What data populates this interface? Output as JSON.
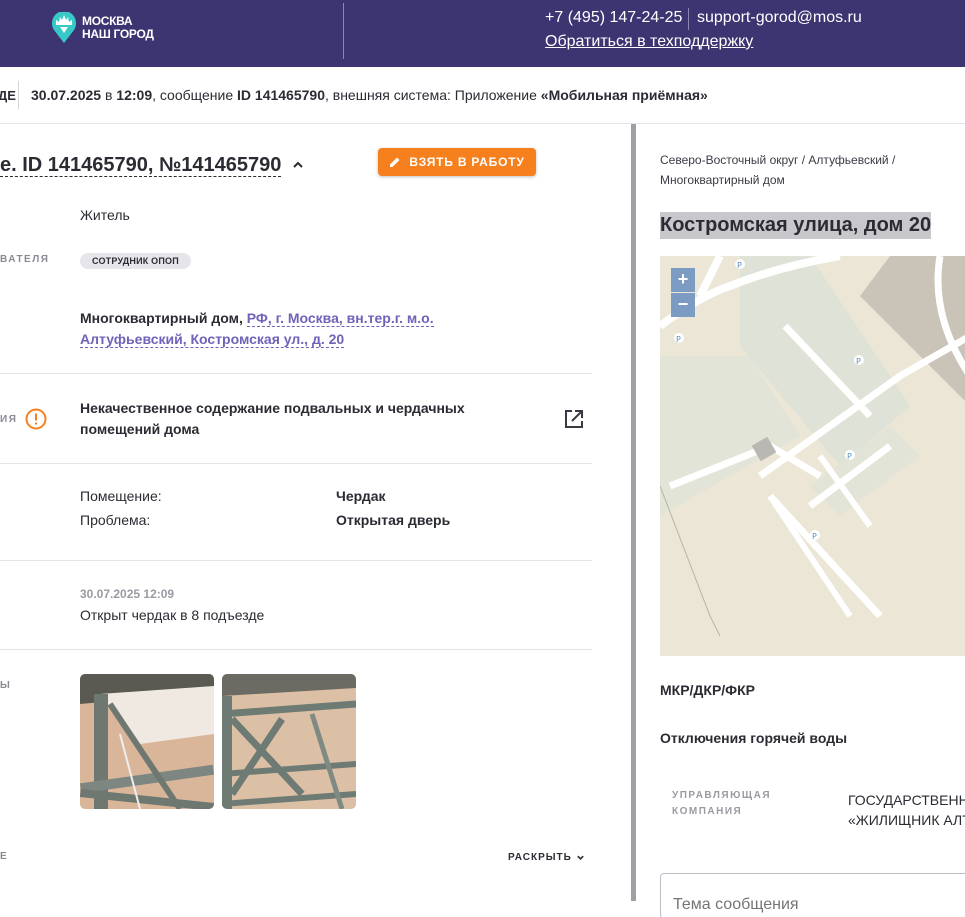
{
  "header": {
    "logo_line1": "МОСКВА",
    "logo_line2": "НАШ ГОРОД",
    "phone": "+7 (495) 147-24-25",
    "email": "support-gorod@mos.ru",
    "support_link": "Обратиться в техподдержку",
    "bg_color": "#3d3472"
  },
  "infobar": {
    "cut_label": "ДЕ",
    "date": "30.07.2025",
    "in_word": "в",
    "time": "12:09",
    "msg_word": ", сообщение",
    "id_label": "ID 141465790",
    "ext_text": ", внешняя система: Приложение",
    "system": "«Мобильная приёмная»"
  },
  "main": {
    "title": "е. ID 141465790, №141465790",
    "take_button": "ВЗЯТЬ В РАБОТУ",
    "applicant_type": "Житель",
    "applicant_label_cut": "ВАТЕЛЯ",
    "role_chip": "СОТРУДНИК ОПОП",
    "address_prefix": "Многоквартирный дом,",
    "address_link": "РФ, г. Москва, вн.тер.г. м.о. Алтуфьевский, Костромская ул., д. 20",
    "category_label_cut": "ИЯ",
    "problem": "Некачественное содержание подвальных и чердачных помещений дома",
    "details": [
      {
        "key": "Помещение:",
        "value": "Чердак"
      },
      {
        "key": "Проблема:",
        "value": "Открытая дверь"
      }
    ],
    "message_date": "30.07.2025 12:09",
    "message_text": "Открыт чердак в 8 подъезде",
    "photos_label_cut": "Ы",
    "bottom_label_cut": "Е",
    "expand": "РАСКРЫТЬ",
    "accent_color": "#f7801e",
    "link_color": "#6e63b8"
  },
  "right": {
    "breadcrumbs": "Северо-Восточный округ / Алтуфьевский / Многоквартирный дом",
    "street": "Костромская улица, дом 20",
    "zoom_in": "+",
    "zoom_out": "−",
    "mkr": "МКР/ДКР/ФКР",
    "hot_water": "Отключения горячей воды",
    "uk_label": "УПРАВЛЯЮЩАЯ КОМПАНИЯ",
    "uk_value_line1": "ГОСУДАРСТВЕННОЕ",
    "uk_value_line2": "«ЖИЛИЩНИК АЛТУ",
    "subject_placeholder": "Тема сообщения"
  }
}
